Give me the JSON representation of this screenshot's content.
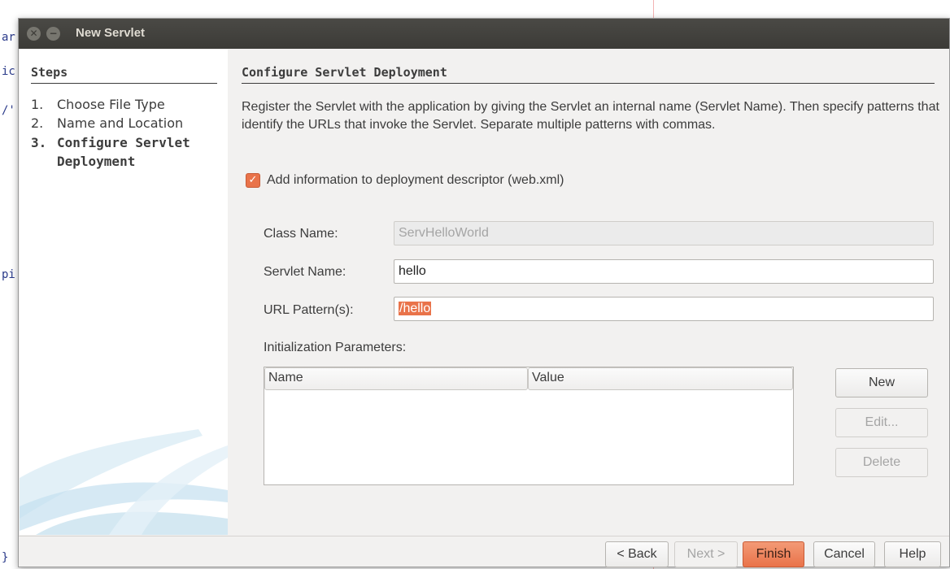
{
  "background": {
    "gutter_lines": [
      "ar",
      "ic",
      "/'",
      "pi",
      "}"
    ]
  },
  "dialog": {
    "title": "New Servlet",
    "close_symbol": "✕",
    "minimize_symbol": "−"
  },
  "steps": {
    "title": "Steps",
    "items": [
      {
        "num": "1.",
        "label": "Choose File Type"
      },
      {
        "num": "2.",
        "label": "Name and Location"
      },
      {
        "num": "3.",
        "label": "Configure Servlet"
      },
      {
        "num": "",
        "label": "Deployment"
      }
    ]
  },
  "main": {
    "title": "Configure Servlet Deployment",
    "description": "Register the Servlet with the application by giving the Servlet an internal name (Servlet Name). Then specify patterns that identify the URLs that invoke the Servlet. Separate multiple patterns with commas.",
    "add_info_checkbox": {
      "label": "Add information to deployment descriptor (web.xml)",
      "checked": true,
      "check_symbol": "✓"
    },
    "class_name": {
      "label": "Class Name:",
      "value": "ServHelloWorld"
    },
    "servlet_name": {
      "label": "Servlet Name:",
      "value": "hello"
    },
    "url_pattern": {
      "label": "URL Pattern(s):",
      "value": "/hello"
    },
    "init_params": {
      "label": "Initialization Parameters:",
      "columns": [
        "Name",
        "Value"
      ]
    },
    "buttons": {
      "new": "New",
      "edit": "Edit...",
      "delete": "Delete"
    }
  },
  "footer": {
    "back": "< Back",
    "next": "Next >",
    "finish": "Finish",
    "cancel": "Cancel",
    "help": "Help"
  },
  "colors": {
    "accent": "#e9734a",
    "titlebar": "#3c3b37",
    "dialog_bg": "#f2f1f0"
  }
}
